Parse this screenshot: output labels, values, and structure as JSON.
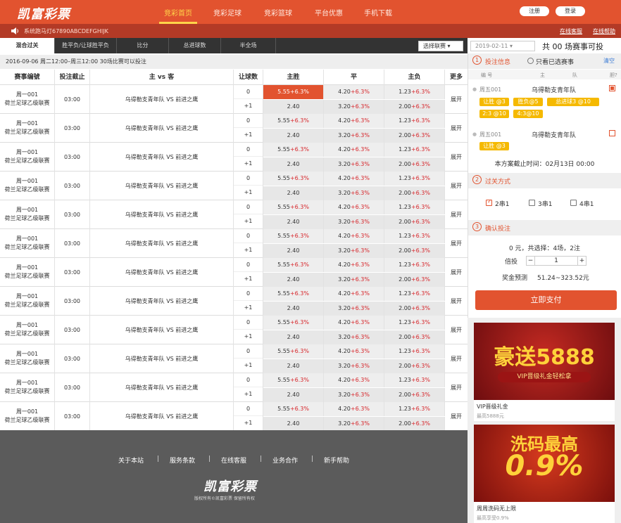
{
  "header": {
    "logo": "凯富彩票",
    "nav": [
      "竞彩首页",
      "竞彩足球",
      "竞彩篮球",
      "平台优惠",
      "手机下载"
    ],
    "register": "注册",
    "login": "登录"
  },
  "subbar": {
    "ticker": "系统跑马灯67890ABCDEFGHIJK",
    "service": "在线客服",
    "help": "在线帮助"
  },
  "tabs": [
    "混合过关",
    "胜平负/让球胜平负",
    "比分",
    "总进球数",
    "半全场"
  ],
  "controls": {
    "league_select": "选择联赛",
    "date": "2019-02-11",
    "match_count": "共 00 场赛事可投"
  },
  "dateline": "2016-09-06  周二12:00–周三12:00    30场比赛可以投注",
  "table": {
    "headers": [
      "赛事编號",
      "投注截止",
      "主 vs 客",
      "让球数",
      "主胜",
      "平",
      "主负",
      "更多"
    ],
    "rows": [
      {
        "id": "周一001",
        "league": "荷兰足球乙级联赛",
        "time": "03:00",
        "teams": "乌得勒支青年队 VS 前进之鹰",
        "h1": "0",
        "h2": "+1",
        "w1": "5.55",
        "w1p": "+6.3%",
        "d1": "4.20",
        "d1p": "+6.3%",
        "l1": "1.23",
        "l1p": "+6.3%",
        "w2": "2.40",
        "d2": "3.20",
        "d2p": "+6.3%",
        "l2": "2.00",
        "l2p": "+6.3%",
        "more": "展开"
      },
      {
        "id": "周一001",
        "league": "荷兰足球乙级联赛",
        "time": "03:00",
        "teams": "乌得勒支青年队 VS 前进之鹰",
        "h1": "0",
        "h2": "+1",
        "w1": "5.55",
        "w1p": "+6.3%",
        "d1": "4.20",
        "d1p": "+6.3%",
        "l1": "1.23",
        "l1p": "+6.3%",
        "w2": "2.40",
        "d2": "3.20",
        "d2p": "+6.3%",
        "l2": "2.00",
        "l2p": "+6.3%",
        "more": "展开"
      },
      {
        "id": "周一001",
        "league": "荷兰足球乙级联赛",
        "time": "03:00",
        "teams": "乌得勒支青年队 VS 前进之鹰",
        "h1": "0",
        "h2": "+1",
        "w1": "5.55",
        "w1p": "+6.3%",
        "d1": "4.20",
        "d1p": "+6.3%",
        "l1": "1.23",
        "l1p": "+6.3%",
        "w2": "2.40",
        "d2": "3.20",
        "d2p": "+6.3%",
        "l2": "2.00",
        "l2p": "+6.3%",
        "more": "展开"
      },
      {
        "id": "周一001",
        "league": "荷兰足球乙级联赛",
        "time": "03:00",
        "teams": "乌得勒支青年队 VS 前进之鹰",
        "h1": "0",
        "h2": "+1",
        "w1": "5.55",
        "w1p": "+6.3%",
        "d1": "4.20",
        "d1p": "+6.3%",
        "l1": "1.23",
        "l1p": "+6.3%",
        "w2": "2.40",
        "d2": "3.20",
        "d2p": "+6.3%",
        "l2": "2.00",
        "l2p": "+6.3%",
        "more": "展开"
      },
      {
        "id": "周一001",
        "league": "荷兰足球乙级联赛",
        "time": "03:00",
        "teams": "乌得勒支青年队 VS 前进之鹰",
        "h1": "0",
        "h2": "+1",
        "w1": "5.55",
        "w1p": "+6.3%",
        "d1": "4.20",
        "d1p": "+6.3%",
        "l1": "1.23",
        "l1p": "+6.3%",
        "w2": "2.40",
        "d2": "3.20",
        "d2p": "+6.3%",
        "l2": "2.00",
        "l2p": "+6.3%",
        "more": "展开"
      },
      {
        "id": "周一001",
        "league": "荷兰足球乙级联赛",
        "time": "03:00",
        "teams": "乌得勒支青年队 VS 前进之鹰",
        "h1": "0",
        "h2": "+1",
        "w1": "5.55",
        "w1p": "+6.3%",
        "d1": "4.20",
        "d1p": "+6.3%",
        "l1": "1.23",
        "l1p": "+6.3%",
        "w2": "2.40",
        "d2": "3.20",
        "d2p": "+6.3%",
        "l2": "2.00",
        "l2p": "+6.3%",
        "more": "展开"
      },
      {
        "id": "周一001",
        "league": "荷兰足球乙级联赛",
        "time": "03:00",
        "teams": "乌得勒支青年队 VS 前进之鹰",
        "h1": "0",
        "h2": "+1",
        "w1": "5.55",
        "w1p": "+6.3%",
        "d1": "4.20",
        "d1p": "+6.3%",
        "l1": "1.23",
        "l1p": "+6.3%",
        "w2": "2.40",
        "d2": "3.20",
        "d2p": "+6.3%",
        "l2": "2.00",
        "l2p": "+6.3%",
        "more": "展开"
      },
      {
        "id": "周一001",
        "league": "荷兰足球乙级联赛",
        "time": "03:00",
        "teams": "乌得勒支青年队 VS 前进之鹰",
        "h1": "0",
        "h2": "+1",
        "w1": "5.55",
        "w1p": "+6.3%",
        "d1": "4.20",
        "d1p": "+6.3%",
        "l1": "1.23",
        "l1p": "+6.3%",
        "w2": "2.40",
        "d2": "3.20",
        "d2p": "+6.3%",
        "l2": "2.00",
        "l2p": "+6.3%",
        "more": "展开"
      },
      {
        "id": "周一001",
        "league": "荷兰足球乙级联赛",
        "time": "03:00",
        "teams": "乌得勒支青年队 VS 前进之鹰",
        "h1": "0",
        "h2": "+1",
        "w1": "5.55",
        "w1p": "+6.3%",
        "d1": "4.20",
        "d1p": "+6.3%",
        "l1": "1.23",
        "l1p": "+6.3%",
        "w2": "2.40",
        "d2": "3.20",
        "d2p": "+6.3%",
        "l2": "2.00",
        "l2p": "+6.3%",
        "more": "展开"
      },
      {
        "id": "周一001",
        "league": "荷兰足球乙级联赛",
        "time": "03:00",
        "teams": "乌得勒支青年队 VS 前进之鹰",
        "h1": "0",
        "h2": "+1",
        "w1": "5.55",
        "w1p": "+6.3%",
        "d1": "4.20",
        "d1p": "+6.3%",
        "l1": "1.23",
        "l1p": "+6.3%",
        "w2": "2.40",
        "d2": "3.20",
        "d2p": "+6.3%",
        "l2": "2.00",
        "l2p": "+6.3%",
        "more": "展开"
      },
      {
        "id": "周一001",
        "league": "荷兰足球乙级联赛",
        "time": "03:00",
        "teams": "乌得勒支青年队 VS 前进之鹰",
        "h1": "0",
        "h2": "+1",
        "w1": "5.55",
        "w1p": "+6.3%",
        "d1": "4.20",
        "d1p": "+6.3%",
        "l1": "1.23",
        "l1p": "+6.3%",
        "w2": "2.40",
        "d2": "3.20",
        "d2p": "+6.3%",
        "l2": "2.00",
        "l2p": "+6.3%",
        "more": "展开"
      },
      {
        "id": "周一001",
        "league": "荷兰足球乙级联赛",
        "time": "03:00",
        "teams": "乌得勒支青年队 VS 前进之鹰",
        "h1": "0",
        "h2": "+1",
        "w1": "5.55",
        "w1p": "+6.3%",
        "d1": "4.20",
        "d1p": "+6.3%",
        "l1": "1.23",
        "l1p": "+6.3%",
        "w2": "2.40",
        "d2": "3.20",
        "d2p": "+6.3%",
        "l2": "2.00",
        "l2p": "+6.3%",
        "more": "展开"
      }
    ]
  },
  "panel": {
    "sec1_num": "1",
    "sec1_title": "投注信息",
    "only_selected": "只看已选赛事",
    "clear": "清空",
    "cols": [
      "编 号",
      "主",
      "队",
      "胆?"
    ],
    "sel1": {
      "id": "周五001",
      "team": "乌得勒支青年队",
      "chips": [
        "让胜 @3",
        "胜负@5",
        "总进球3 @10",
        "2:3 @10",
        "4:3@10"
      ]
    },
    "sel2": {
      "id": "周五001",
      "team": "乌得勒支青年队",
      "chips": [
        "让胜 @3"
      ]
    },
    "deadline": "本方案截止时间：02月13日 00:00",
    "sec2_num": "2",
    "sec2_title": "过关方式",
    "pass": [
      "2串1",
      "3串1",
      "4串1"
    ],
    "sec3_num": "3",
    "sec3_title": "确认投注",
    "summary": "0 元，共选择：4场，2注",
    "multi_label": "倍投",
    "multi_minus": "−",
    "multi_value": "1",
    "multi_plus": "+",
    "prize_label": "奖金预测",
    "prize": "51.24~323.52元",
    "pay": "立即支付"
  },
  "ads": [
    {
      "img_big": "豪送5888",
      "img_sub": "VIP晋级礼金轻松拿",
      "title": "VIP晋级礼金",
      "sub": "最高5888元"
    },
    {
      "img_big1": "洗码最高",
      "img_big2": "0.9%",
      "title": "周周洗码无上限",
      "sub": "最高享受0.9%"
    }
  ],
  "footer": {
    "links": [
      "关于本站",
      "服务条款",
      "在线客服",
      "业务合作",
      "新手帮助"
    ],
    "sep": "|",
    "logo": "凯富彩票",
    "copyright": "版权所有©凯富彩票 保留所有权"
  },
  "colors": {
    "brand": "#e2532f",
    "dark_bar": "#b33a26",
    "highlight": "#e2532f",
    "pct": "#d7262b",
    "chip": "#f5b900"
  }
}
